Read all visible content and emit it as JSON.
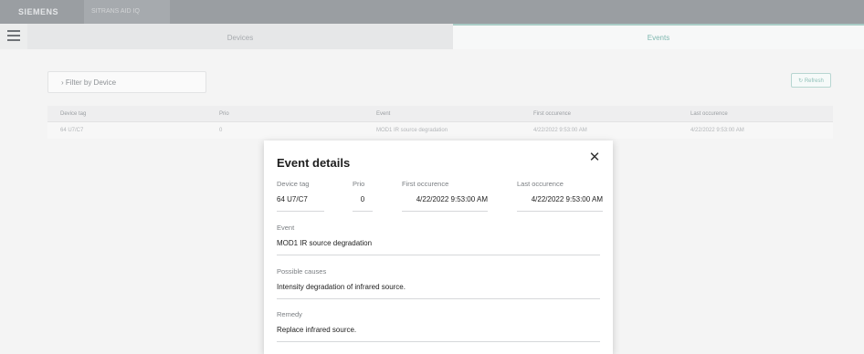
{
  "titlebar": {
    "brand": "SIEMENS",
    "product": "SITRANS AID IQ"
  },
  "tabs": {
    "devices": "Devices",
    "events": "Events"
  },
  "filter": {
    "label": "› Filter by Device"
  },
  "refresh": {
    "label": "↻ Refresh"
  },
  "table": {
    "headers": [
      "Device tag",
      "Prio",
      "Event",
      "First occurence",
      "Last occurence"
    ],
    "rows": [
      [
        "64 U7/C7",
        "0",
        "MOD1 IR source degradation",
        "4/22/2022 9:53:00 AM",
        "4/22/2022 9:53:00 AM"
      ]
    ]
  },
  "modal": {
    "title": "Event details",
    "close": "✕",
    "device_tag": {
      "label": "Device tag",
      "value": "64 U7/C7"
    },
    "prio": {
      "label": "Prio",
      "value": "0"
    },
    "first": {
      "label": "First occurence",
      "value": "4/22/2022 9:53:00 AM"
    },
    "last": {
      "label": "Last occurence",
      "value": "4/22/2022 9:53:00 AM"
    },
    "event": {
      "label": "Event",
      "value": "MOD1 IR source degradation"
    },
    "causes": {
      "label": "Possible causes",
      "value": "Intensity degradation of infrared source."
    },
    "remedy": {
      "label": "Remedy",
      "value": "Replace infrared source."
    }
  }
}
